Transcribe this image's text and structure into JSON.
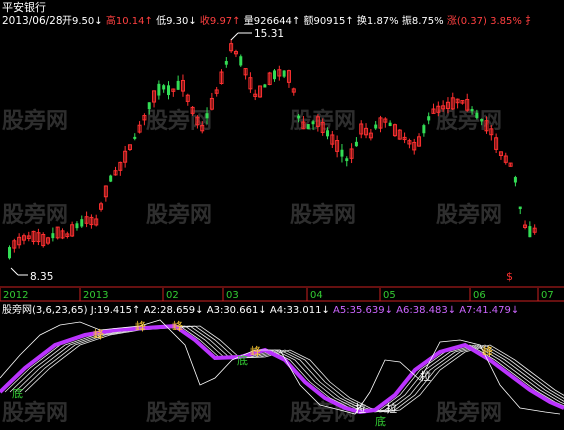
{
  "stock": {
    "name": "平安银行",
    "date": "2013/06/28",
    "fields": [
      {
        "label": "开",
        "value": "9.50",
        "arrow": "↓",
        "color": "#ffffff"
      },
      {
        "label": "高",
        "value": "10.14",
        "arrow": "↑",
        "color": "#ff4040"
      },
      {
        "label": "低",
        "value": "9.30",
        "arrow": "↓",
        "color": "#ffffff"
      },
      {
        "label": "收",
        "value": "9.97",
        "arrow": "↑",
        "color": "#ff4040"
      },
      {
        "label": "量",
        "value": "926644",
        "arrow": "↑",
        "color": "#ffffff"
      },
      {
        "label": "额",
        "value": "90915",
        "arrow": "↑",
        "color": "#ffffff"
      },
      {
        "label": "换",
        "value": "1.87%",
        "arrow": "",
        "color": "#ffffff"
      },
      {
        "label": "振",
        "value": "8.75%",
        "arrow": "",
        "color": "#ffffff"
      },
      {
        "label": "涨",
        "value": "(0.37)",
        "arrow": "",
        "color": "#ff4040"
      },
      {
        "label": "",
        "value": "3.85%",
        "arrow": "",
        "color": "#ff4040"
      },
      {
        "label": "扌",
        "value": "",
        "arrow": "",
        "color": "#ff4040"
      }
    ],
    "max_price_label": "15.31",
    "min_price_label": "8.35",
    "timeline": [
      "2012",
      "2013",
      "02",
      "03",
      "04",
      "05",
      "06",
      "07"
    ]
  },
  "watermark": "股旁网",
  "indicator": {
    "name": "股旁网",
    "params": "(3,6,23,65)",
    "values": [
      {
        "label": "J:",
        "value": "19.415↑",
        "color": "#ffffff"
      },
      {
        "label": "A2:",
        "value": "28.659↓",
        "color": "#ffffff"
      },
      {
        "label": "A3:",
        "value": "30.661↓",
        "color": "#ffffff"
      },
      {
        "label": "A4:",
        "value": "33.011↓",
        "color": "#ffffff"
      },
      {
        "label": "A5:",
        "value": "35.639↓",
        "color": "#cc66ff"
      },
      {
        "label": "A6:",
        "value": "38.483↓",
        "color": "#cc66ff"
      },
      {
        "label": "A7:",
        "value": "41.479↓",
        "color": "#cc66ff"
      }
    ],
    "signals": [
      "底",
      "峰",
      "峰",
      "峰",
      "底",
      "峰",
      "拉",
      "底",
      "拉",
      "拉",
      "峰"
    ]
  },
  "colors": {
    "background": "#000000",
    "up_candle": "#ff3030",
    "down_candle": "#33dd55",
    "axis": "#cc2020",
    "date_text": "#33cc33",
    "purple": "#bb33ff",
    "text_white": "#ffffff"
  }
}
